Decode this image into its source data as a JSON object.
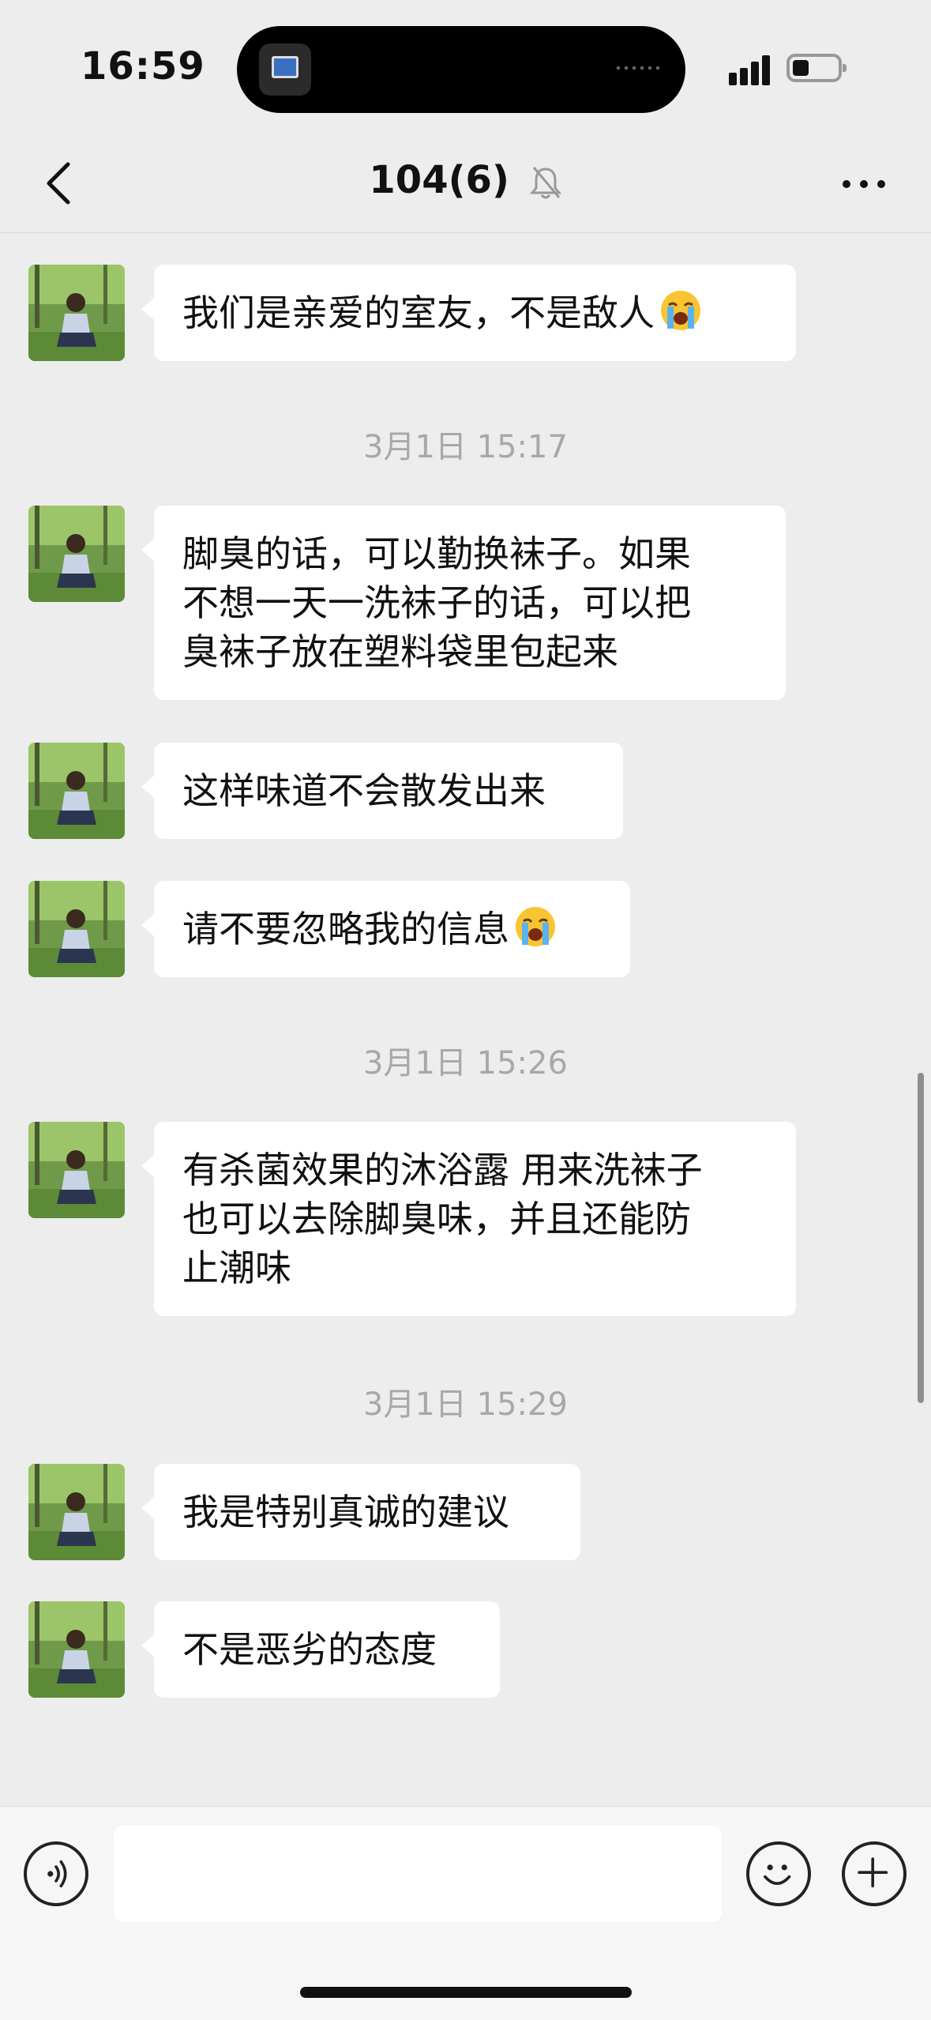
{
  "status_bar": {
    "time": "16:59",
    "battery_level": 0.3,
    "signal_bars": 4
  },
  "nav": {
    "title": "104(6)",
    "muted": true,
    "back_icon": "chevron-left-icon",
    "more_icon": "more-dots-icon",
    "mute_icon": "bell-off-icon"
  },
  "messages": [
    {
      "type": "text",
      "text": "我们是亲爱的室友，不是敌人",
      "emoji": "loudly-crying-face"
    },
    {
      "type": "time",
      "text": "3月1日 15:17"
    },
    {
      "type": "text",
      "lines": [
        "脚臭的话，可以勤换袜子。如果",
        "不想一天一洗袜子的话，可以把",
        "臭袜子放在塑料袋里包起来"
      ]
    },
    {
      "type": "text",
      "text": "这样味道不会散发出来"
    },
    {
      "type": "text",
      "text": "请不要忽略我的信息",
      "emoji": "loudly-crying-face"
    },
    {
      "type": "time",
      "text": "3月1日 15:26"
    },
    {
      "type": "text",
      "lines": [
        "有杀菌效果的沐浴露 用来洗袜子",
        "也可以去除脚臭味，并且还能防",
        "止潮味"
      ]
    },
    {
      "type": "time",
      "text": "3月1日 15:29"
    },
    {
      "type": "text",
      "text": "我是特别真诚的建议"
    },
    {
      "type": "text",
      "text": "不是恶劣的态度"
    }
  ],
  "input_bar": {
    "voice_icon": "voice-icon",
    "placeholder": "",
    "emoji_icon": "smiley-icon",
    "add_icon": "plus-icon"
  },
  "colors": {
    "background": "#ededed",
    "bubble": "#ffffff",
    "timestamp": "#a8a8a8",
    "input_bar": "#f6f6f6"
  }
}
